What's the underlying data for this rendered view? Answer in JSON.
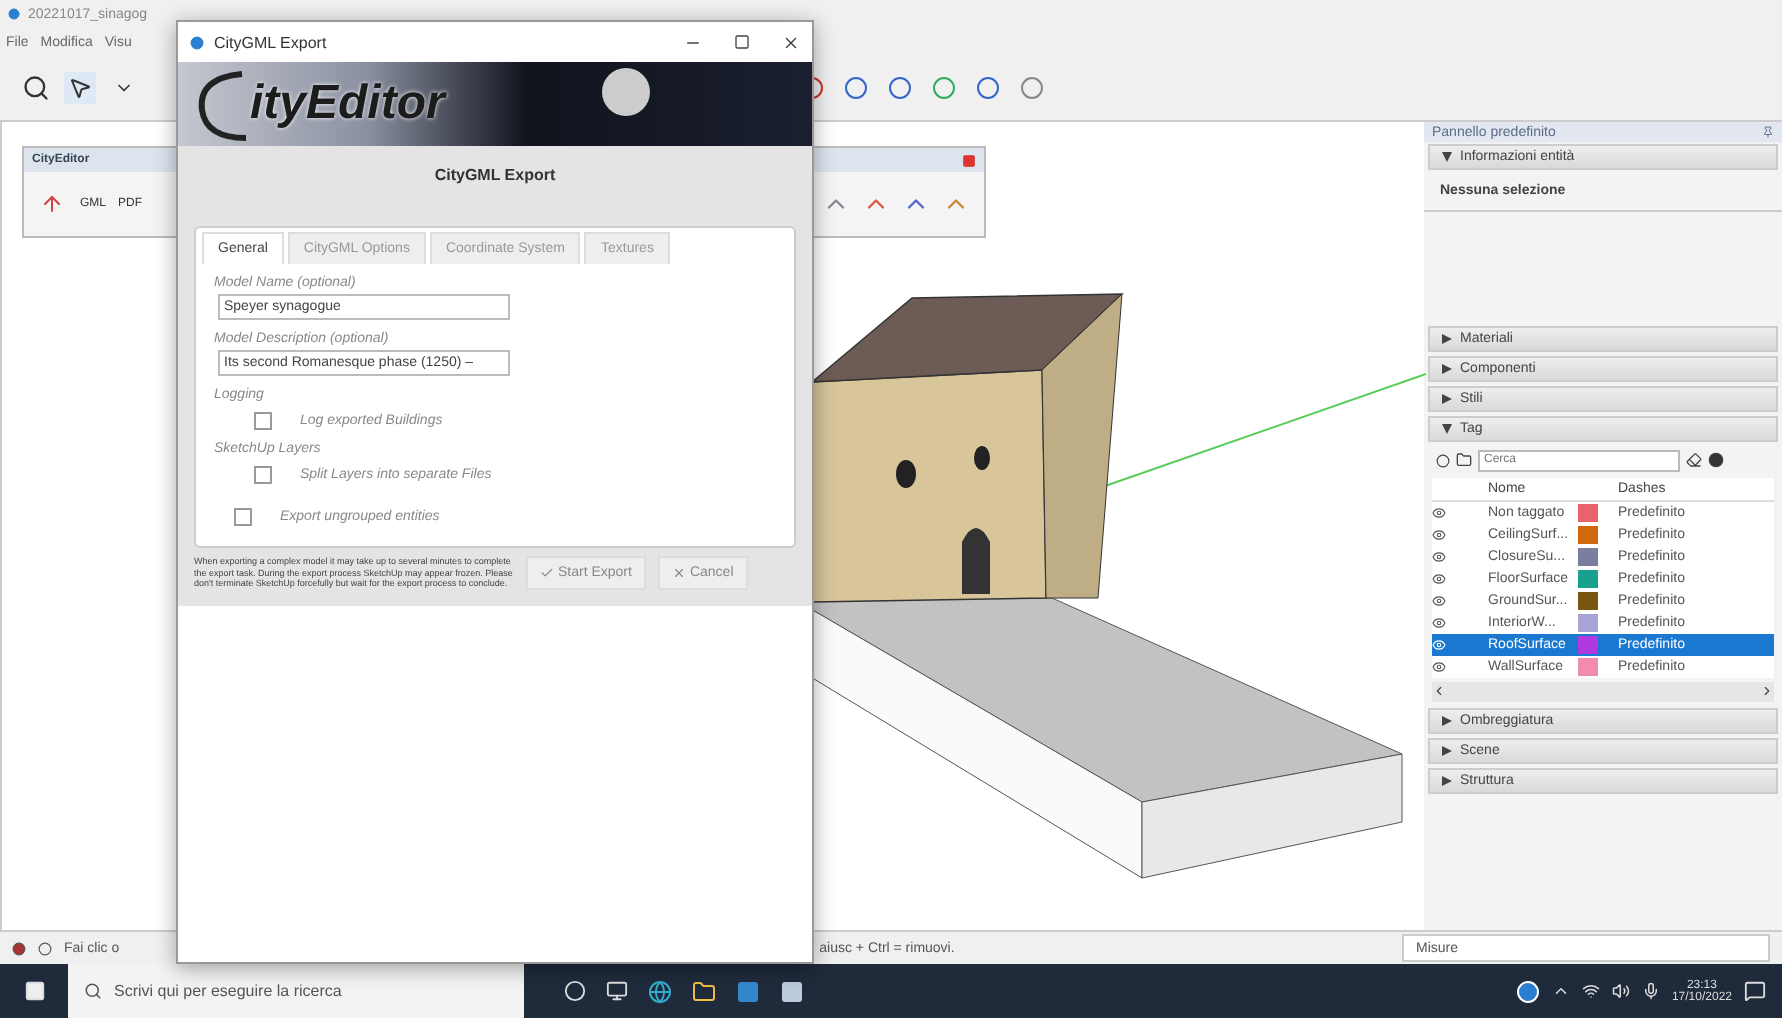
{
  "app": {
    "title": "20221017_sinagog",
    "menu": [
      "File",
      "Modifica",
      "Visu"
    ]
  },
  "city_editor_toolbar": {
    "title": "CityEditor",
    "buttons": [
      "GML",
      "PDF"
    ]
  },
  "dialog": {
    "title": "CityGML Export",
    "banner_logo": "ityEditor",
    "heading": "CityGML Export",
    "tabs": [
      {
        "label": "General",
        "selected": true
      },
      {
        "label": "CityGML Options",
        "selected": false
      },
      {
        "label": "Coordinate System",
        "selected": false
      },
      {
        "label": "Textures",
        "selected": false
      }
    ],
    "fields": [
      {
        "label": "Model Name (optional)",
        "value": "Speyer synagogue"
      },
      {
        "label": "Model Description (optional)",
        "value": "Its second Romanesque phase (1250) –"
      }
    ],
    "options": [
      {
        "kind": "group",
        "label": "Logging"
      },
      {
        "kind": "checkbox",
        "label": "Log exported Buildings",
        "checked": false
      },
      {
        "kind": "group",
        "label": "SketchUp Layers"
      },
      {
        "kind": "checkbox",
        "label": "Split Layers into separate Files",
        "checked": false
      },
      {
        "kind": "checkbox",
        "label": "Export ungrouped entities",
        "checked": false
      }
    ],
    "note": "When exporting a complex model it may take up to several minutes to complete the export task. During the export process SketchUp may appear frozen. Please don't terminate SketchUp forcefully but wait for the export process to conclude.",
    "buttons": [
      {
        "kind": "confirm",
        "label": "Start Export"
      },
      {
        "kind": "cancel",
        "label": "Cancel"
      }
    ]
  },
  "panel": {
    "title": "Pannello predefinito",
    "entity_info": {
      "label": "Informazioni entità",
      "expanded": true,
      "text": "Nessuna selezione"
    },
    "sections_top": [
      {
        "label": "Materiali",
        "expanded": false
      },
      {
        "label": "Componenti",
        "expanded": false
      },
      {
        "label": "Stili",
        "expanded": false
      },
      {
        "label": "Tag",
        "expanded": true
      }
    ],
    "tags": {
      "search_placeholder": "Cerca",
      "columns": [
        "Nome",
        "Dashes"
      ],
      "rows": [
        {
          "name": "Non taggato",
          "color": "#e8636b",
          "dashes": "Predefinito",
          "selected": false
        },
        {
          "name": "CeilingSurf...",
          "color": "#d3690f",
          "dashes": "Predefinito",
          "selected": false
        },
        {
          "name": "ClosureSu...",
          "color": "#7a7fa0",
          "dashes": "Predefinito",
          "selected": false
        },
        {
          "name": "FloorSurface",
          "color": "#1aa18d",
          "dashes": "Predefinito",
          "selected": false
        },
        {
          "name": "GroundSur...",
          "color": "#7a5510",
          "dashes": "Predefinito",
          "selected": false
        },
        {
          "name": "InteriorW...",
          "color": "#a8a4d8",
          "dashes": "Predefinito",
          "selected": false
        },
        {
          "name": "RoofSurface",
          "color": "#b03ae0",
          "dashes": "Predefinito",
          "selected": true
        },
        {
          "name": "WallSurface",
          "color": "#f28bb0",
          "dashes": "Predefinito",
          "selected": false
        }
      ]
    },
    "sections_bottom": [
      {
        "label": "Ombreggiatura",
        "expanded": false
      },
      {
        "label": "Scene",
        "expanded": false
      },
      {
        "label": "Struttura",
        "expanded": false
      }
    ]
  },
  "status_bar": {
    "hint_left": "Fai clic o",
    "hint_right": "aiusc + Ctrl = rimuovi.",
    "measure_label": "Misure"
  },
  "taskbar": {
    "search_placeholder": "Scrivi qui per eseguire la ricerca",
    "time": "23:13",
    "date": "17/10/2022"
  }
}
